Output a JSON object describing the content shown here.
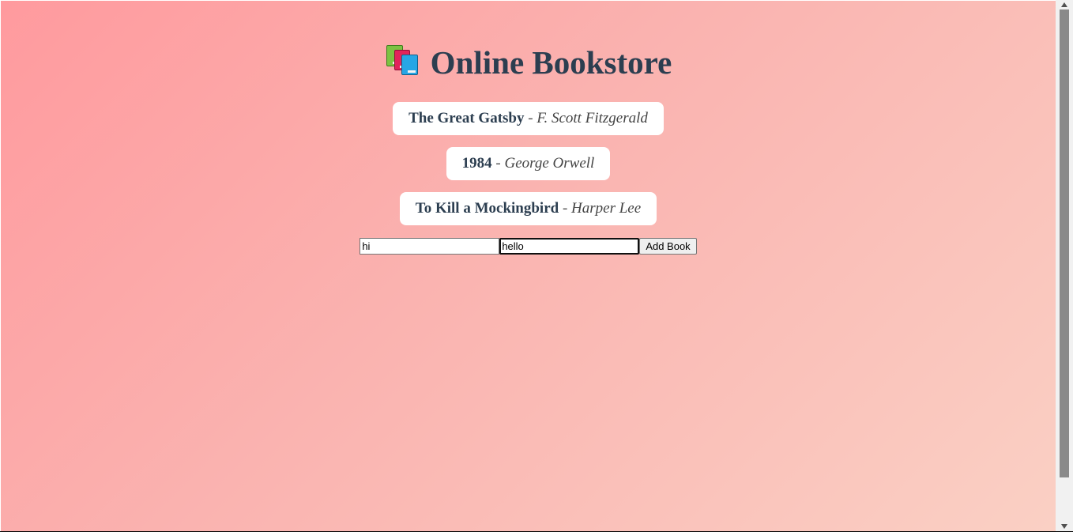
{
  "page": {
    "title": "Online Bookstore",
    "title_icon": "books-icon"
  },
  "books": [
    {
      "title": "The Great Gatsby",
      "author": "F. Scott Fitzgerald"
    },
    {
      "title": "1984",
      "author": "George Orwell"
    },
    {
      "title": "To Kill a Mockingbird",
      "author": "Harper Lee"
    }
  ],
  "separator": "-",
  "form": {
    "title_value": "hi",
    "author_value": "hello",
    "submit_label": "Add Book"
  },
  "colors": {
    "gradient_start": "#ff9a9e",
    "gradient_end": "#fad0c4",
    "heading": "#2c3e50",
    "card": "#ffffff"
  }
}
